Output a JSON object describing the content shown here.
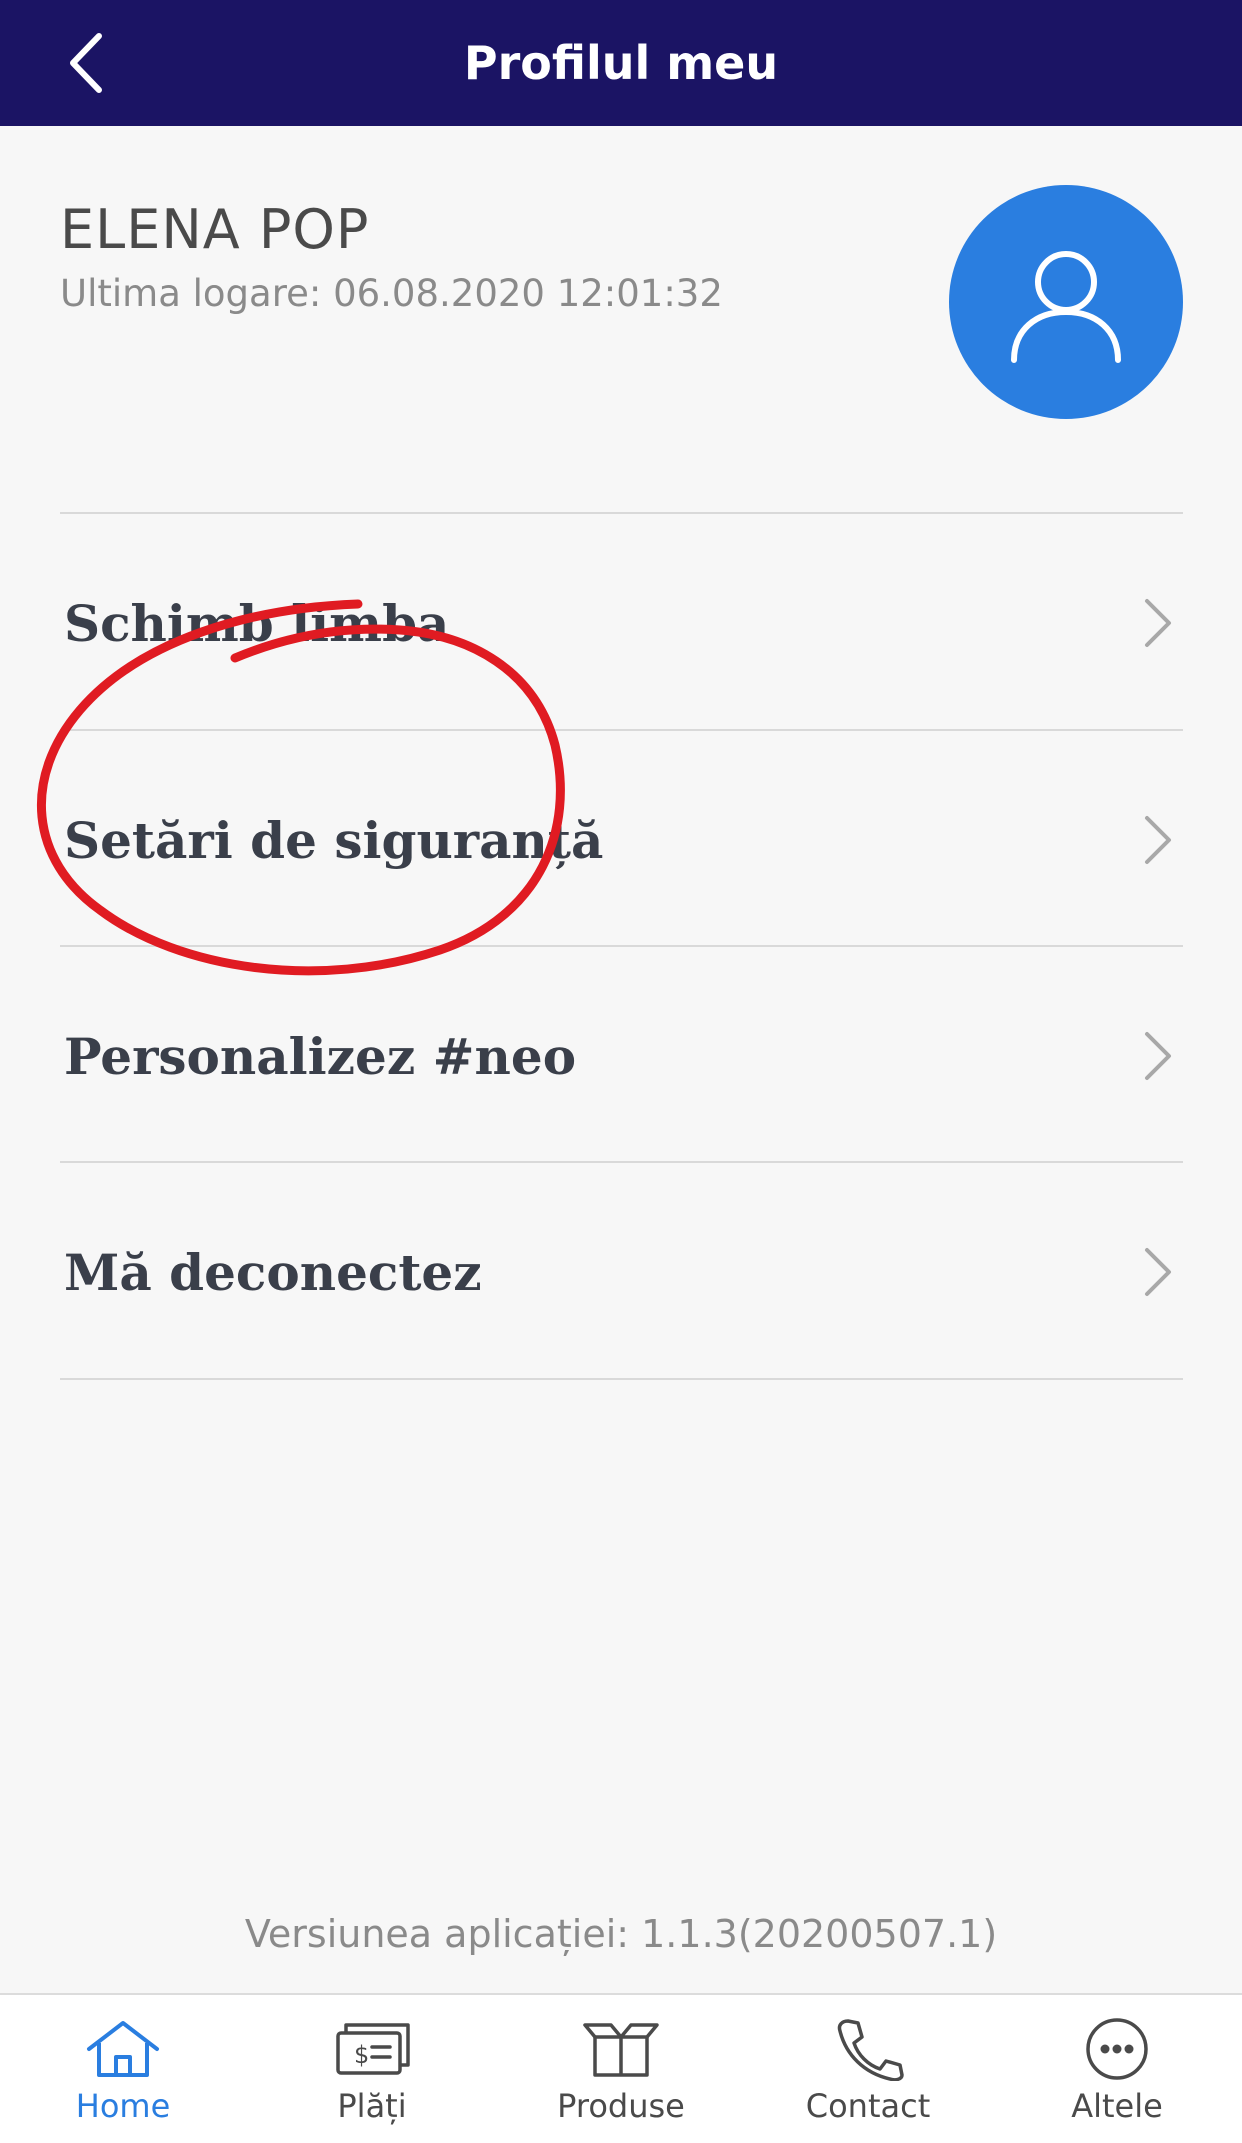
{
  "header": {
    "title": "Profilul meu",
    "back_icon": "chevron-left-icon",
    "background": "#1b1464"
  },
  "profile": {
    "name": "ELENA POP",
    "last_login": "Ultima logare: 06.08.2020 12:01:32",
    "avatar_icon": "user-icon",
    "avatar_color": "#2a7ee0"
  },
  "menu": {
    "items": [
      {
        "label": "Schimb limba",
        "icon": "chevron-right-icon"
      },
      {
        "label": "Setări de siguranță",
        "icon": "chevron-right-icon"
      },
      {
        "label": "Personalizez #neo",
        "icon": "chevron-right-icon"
      },
      {
        "label": "Mă deconectez",
        "icon": "chevron-right-icon"
      }
    ]
  },
  "annotation": {
    "color": "#e01b22",
    "shape": "hand-drawn-circle",
    "target": "Setări de siguranță"
  },
  "footer": {
    "version": "Versiunea aplicației: 1.1.3(20200507.1)"
  },
  "tabbar": {
    "active_color": "#2a7ee0",
    "tabs": [
      {
        "label": "Home",
        "icon": "home-icon",
        "active": true
      },
      {
        "label": "Plăți",
        "icon": "payment-icon",
        "active": false
      },
      {
        "label": "Produse",
        "icon": "box-icon",
        "active": false
      },
      {
        "label": "Contact",
        "icon": "phone-icon",
        "active": false
      },
      {
        "label": "Altele",
        "icon": "more-icon",
        "active": false
      }
    ]
  }
}
